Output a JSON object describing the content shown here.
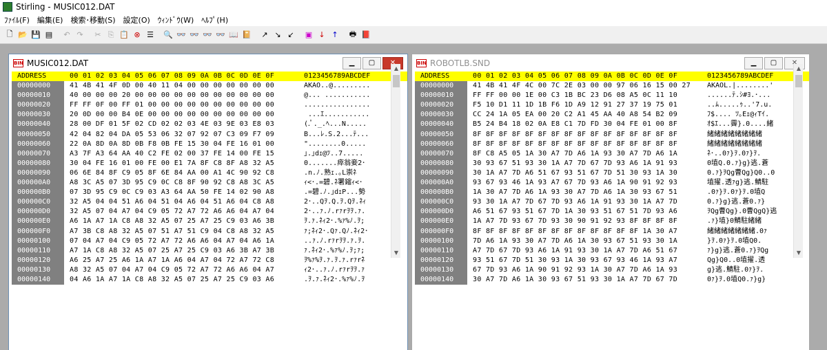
{
  "app": {
    "title": "Stirling - MUSIC012.DAT"
  },
  "menu": [
    "ﾌｧｲﾙ(F)",
    "編集(E)",
    "検索･移動(S)",
    "設定(O)",
    "ｳｨﾝﾄﾞｳ(W)",
    "ﾍﾙﾌﾟ(H)"
  ],
  "toolbar_icons": [
    "new-file-icon",
    "open-file-icon",
    "save-icon",
    "print-setup-icon",
    "undo-icon",
    "redo-icon",
    "cut-icon",
    "copy-icon",
    "paste-icon",
    "delete-icon",
    "select-all-icon",
    "find-icon",
    "find-next-icon",
    "find-prev-icon",
    "replace-icon",
    "find-hex-icon",
    "find-ascii-icon",
    "goto-top-icon",
    "goto-line-icon",
    "goto-end-icon",
    "marker-icon",
    "marker-next-icon",
    "marker-prev-icon",
    "print-icon",
    "help-icon"
  ],
  "header": {
    "addr": "ADDRESS",
    "bytes": "00 01 02 03 04 05 06 07 08 09 0A 0B 0C 0D 0E 0F",
    "ascii": "0123456789ABCDEF"
  },
  "windows": [
    {
      "title": "MUSIC012.DAT",
      "active": true,
      "rows": [
        {
          "addr": "00000000",
          "bytes": "41 4B 41 4F 0D 00 40 11 04 00 00 00 00 00 00 00",
          "ascii": "AKAO..@........."
        },
        {
          "addr": "00000010",
          "bytes": "40 00 00 00 20 00 00 00 00 00 00 00 00 00 00 00",
          "ascii": "@... ..........."
        },
        {
          "addr": "00000020",
          "bytes": "FF FF 0F 00 FF 01 00 00 00 00 00 00 00 00 00 00",
          "ascii": "................"
        },
        {
          "addr": "00000030",
          "bytes": "20 0D 00 00 B4 0E 00 00 00 00 00 00 00 00 00 00",
          "ascii": " ...ｴ..........."
        },
        {
          "addr": "00000040",
          "bytes": "28 00 DF 01 5F 02 CD 02 02 03 4E 03 9E 03 E8 03",
          "ascii": "(.ﾟ._.ﾍ...N....."
        },
        {
          "addr": "00000050",
          "bytes": "42 04 82 04 DA 05 53 06 32 07 92 07 C3 09 F7 09",
          "ascii": "B...ﾚ.S.2...ﾃ..."
        },
        {
          "addr": "00000060",
          "bytes": "22 0A 8D 0A 8D 0B F8 0B FE 15 30 04 FE 16 01 00",
          "ascii": "\"........0....."
        },
        {
          "addr": "00000070",
          "bytes": "A3 7F A3 64 AA 40 C2 FE 02 00 37 FE 14 00 FE 15",
          "ascii": "｣.｣dｪ@ﾂ..7....."
        },
        {
          "addr": "00000080",
          "bytes": "30 04 FE 16 01 00 FE 00 E1 7A 8F C8 8F A8 32 A5",
          "ascii": "0.......瘁翁妾2･"
        },
        {
          "addr": "00000090",
          "bytes": "06 6E 84 8F C9 05 8F 6E 84 AA 00 A1 4C 90 92 C8",
          "ascii": ".n.ﾉ.熟ｪ.｡L崇ﾈ"
        },
        {
          "addr": "000000A0",
          "bytes": "A8 3C A5 07 3D 95 C9 0C C8 8F 90 92 C8 A8 3C A5",
          "ascii": "ｨ<･.=碧.ﾈ署鏥ｨ<･"
        },
        {
          "addr": "000000B0",
          "bytes": "07 3D 95 C9 0C C9 03 A3 64 AA 50 FE 14 02 90 A8",
          "ascii": ".=碧.ﾉ.｣dｪP...勢"
        },
        {
          "addr": "000000C0",
          "bytes": "32 A5 04 04 51 A6 04 51 04 A6 04 51 A6 04 C8 A8",
          "ascii": "2･..Qｦ.Q.ｦ.Qｦ.ﾈｨ"
        },
        {
          "addr": "000000D0",
          "bytes": "32 A5 07 04 A7 04 C9 05 72 A7 72 A6 A6 04 A7 04",
          "ascii": "2･..ｧ.ﾉ.rｧrｦｦ.ｧ."
        },
        {
          "addr": "000000E0",
          "bytes": "A6 1A A7 1A C8 A8 32 A5 07 25 A7 25 C9 03 A6 3B",
          "ascii": "ｦ.ｧ.ﾈｨ2･.%ｧ%ﾉ.ｦ;"
        },
        {
          "addr": "000000F0",
          "bytes": "A7 3B C8 A8 32 A5 07 51 A7 51 C9 04 C8 A8 32 A5",
          "ascii": "ｧ;ﾈｨ2･.Qｧ.Qﾉ.ﾈｨ2･"
        },
        {
          "addr": "00000100",
          "bytes": "07 04 A7 04 C9 05 72 A7 72 A6 A6 04 A7 04 A6 1A",
          "ascii": "..ｧ.ﾉ.rｧrｦｦ.ｧ.ｦ."
        },
        {
          "addr": "00000110",
          "bytes": "A7 1A C8 A8 32 A5 07 25 A7 25 C9 03 A6 3B A7 3B",
          "ascii": "ｧ.ﾈｨ2･.%ｧ%ﾉ.ｦ;ｧ;"
        },
        {
          "addr": "00000120",
          "bytes": "A6 25 A7 25 A6 1A A7 1A A6 04 A7 04 72 A7 72 C8",
          "ascii": "ｦ%ｧ%ｦ.ｧ.ｦ.ｧ.rｧrﾈ"
        },
        {
          "addr": "00000130",
          "bytes": "A8 32 A5 07 04 A7 04 C9 05 72 A7 72 A6 A6 04 A7",
          "ascii": "ｨ2･..ｧ.ﾉ.rｧrｦｦ.ｧ"
        },
        {
          "addr": "00000140",
          "bytes": "04 A6 1A A7 1A C8 A8 32 A5 07 25 A7 25 C9 03 A6",
          "ascii": ".ｦ.ｧ.ﾈｨ2･.%ｧ%ﾉ.ｦ"
        }
      ]
    },
    {
      "title": "ROBOTLB.SND",
      "active": false,
      "rows": [
        {
          "addr": "00000000",
          "bytes": "41 4B 41 4F 4C 00 7C 2E 03 00 00 97 06 16 15 00 27",
          "ascii": "AKAOL.|........'"
        },
        {
          "addr": "00000010",
          "bytes": "FF FF 00 00 1E 00 C3 1B BC 23 D6 08 A5 0C 11 10",
          "ascii": "......ﾃ.ｼ#ﾖ.･..."
        },
        {
          "addr": "00000020",
          "bytes": "F5 10 D1 11 1D 1B F6 1D A9 12 91 27 37 19 75 01",
          "ascii": "..ﾑ.....ｩ..'7.u."
        },
        {
          "addr": "00000030",
          "bytes": "CC 24 1A 05 EA 00 20 C2 A1 45 AA 40 A8 54 B2 09",
          "ascii": "ﾌ$.... ﾂ｡Eｪ@ｨTｲ."
        },
        {
          "addr": "00000040",
          "bytes": "B5 24 B4 18 02 0A E8 C1 7D FD 30 04 FE 01 00 8F",
          "ascii": "ｵ$ｴ...霽}.0....緒"
        },
        {
          "addr": "00000050",
          "bytes": "8F 8F 8F 8F 8F 8F 8F 8F 8F 8F 8F 8F 8F 8F 8F 8F",
          "ascii": "緒緒緒緒緒緒緒緒"
        },
        {
          "addr": "00000060",
          "bytes": "8F 8F 8F 8F 8F 8F 8F 8F 8F 8F 8F 8F 8F 8F 8F 8F",
          "ascii": "緒緒緒緒緒緒緒緒"
        },
        {
          "addr": "00000070",
          "bytes": "8F C8 A5 05 1A 30 A7 7D A6 1A 93 30 A7 7D A6 1A",
          "ascii": "ﾈ･..0ｧ}ｦ.0ｧ}ｦ."
        },
        {
          "addr": "00000080",
          "bytes": "30 93 67 51 93 30 1A A7 7D 67 7D 93 A6 1A 91 93",
          "ascii": "0埴Q.0.ｧ}g}逃.蒼"
        },
        {
          "addr": "00000090",
          "bytes": "30 1A A7 7D A6 51 67 93 51 67 7D 51 30 93 1A 30",
          "ascii": "0.ｧ}ｦQg曹Qg}Q0..0"
        },
        {
          "addr": "000000A0",
          "bytes": "93 67 93 46 1A 93 A7 67 7D 93 A6 1A 90 91 92 93",
          "ascii": "埴擢.透ｧg}逃.鯖駐"
        },
        {
          "addr": "000000B0",
          "bytes": "1A 30 A7 7D A6 1A 93 30 A7 7D A6 1A 30 93 67 51",
          "ascii": ".0ｧ}ｦ.0ｧ}ｦ.0埴Q"
        },
        {
          "addr": "000000C0",
          "bytes": "93 30 1A A7 7D 67 7D 93 A6 1A 91 93 30 1A A7 7D",
          "ascii": "0.ｧ}g}逃.蒼0.ｧ}"
        },
        {
          "addr": "000000D0",
          "bytes": "A6 51 67 93 51 67 7D 1A 30 93 51 67 51 7D 93 A6",
          "ascii": "ｦQg曹Qg}.0曹QgQ}逃"
        },
        {
          "addr": "000000E0",
          "bytes": "1A A7 7D 93 67 7D 93 30 90 91 92 93 8F 8F 8F 8F",
          "ascii": ".ｧ}埴}0鯖駐緒緒"
        },
        {
          "addr": "000000F0",
          "bytes": "8F 8F 8F 8F 8F 8F 8F 8F 8F 8F 8F 8F 8F 1A 30 A7",
          "ascii": "緒緒緒緒緒緒緒.0ｧ"
        },
        {
          "addr": "00000100",
          "bytes": "7D A6 1A 93 30 A7 7D A6 1A 30 93 67 51 93 30 1A",
          "ascii": "}ｦ.0ｧ}ｦ.0埴Q0."
        },
        {
          "addr": "00000110",
          "bytes": "A7 7D 67 7D 93 A6 1A 91 93 30 1A A7 7D A6 51 67",
          "ascii": "ｧ}g}逃.蒼0.ｧ}ｦQg"
        },
        {
          "addr": "00000120",
          "bytes": "93 51 67 7D 51 30 93 1A 30 93 67 93 46 1A 93 A7",
          "ascii": "Qg}Q0..0埴擢.透"
        },
        {
          "addr": "00000130",
          "bytes": "67 7D 93 A6 1A 90 91 92 93 1A 30 A7 7D A6 1A 93",
          "ascii": "g}逃.鯖駐.0ｧ}ｦ."
        },
        {
          "addr": "00000140",
          "bytes": "30 A7 7D A6 1A 30 93 67 51 93 30 1A A7 7D 67 7D",
          "ascii": "0ｧ}ｦ.0埴Q0.ｧ}g}"
        }
      ]
    }
  ]
}
